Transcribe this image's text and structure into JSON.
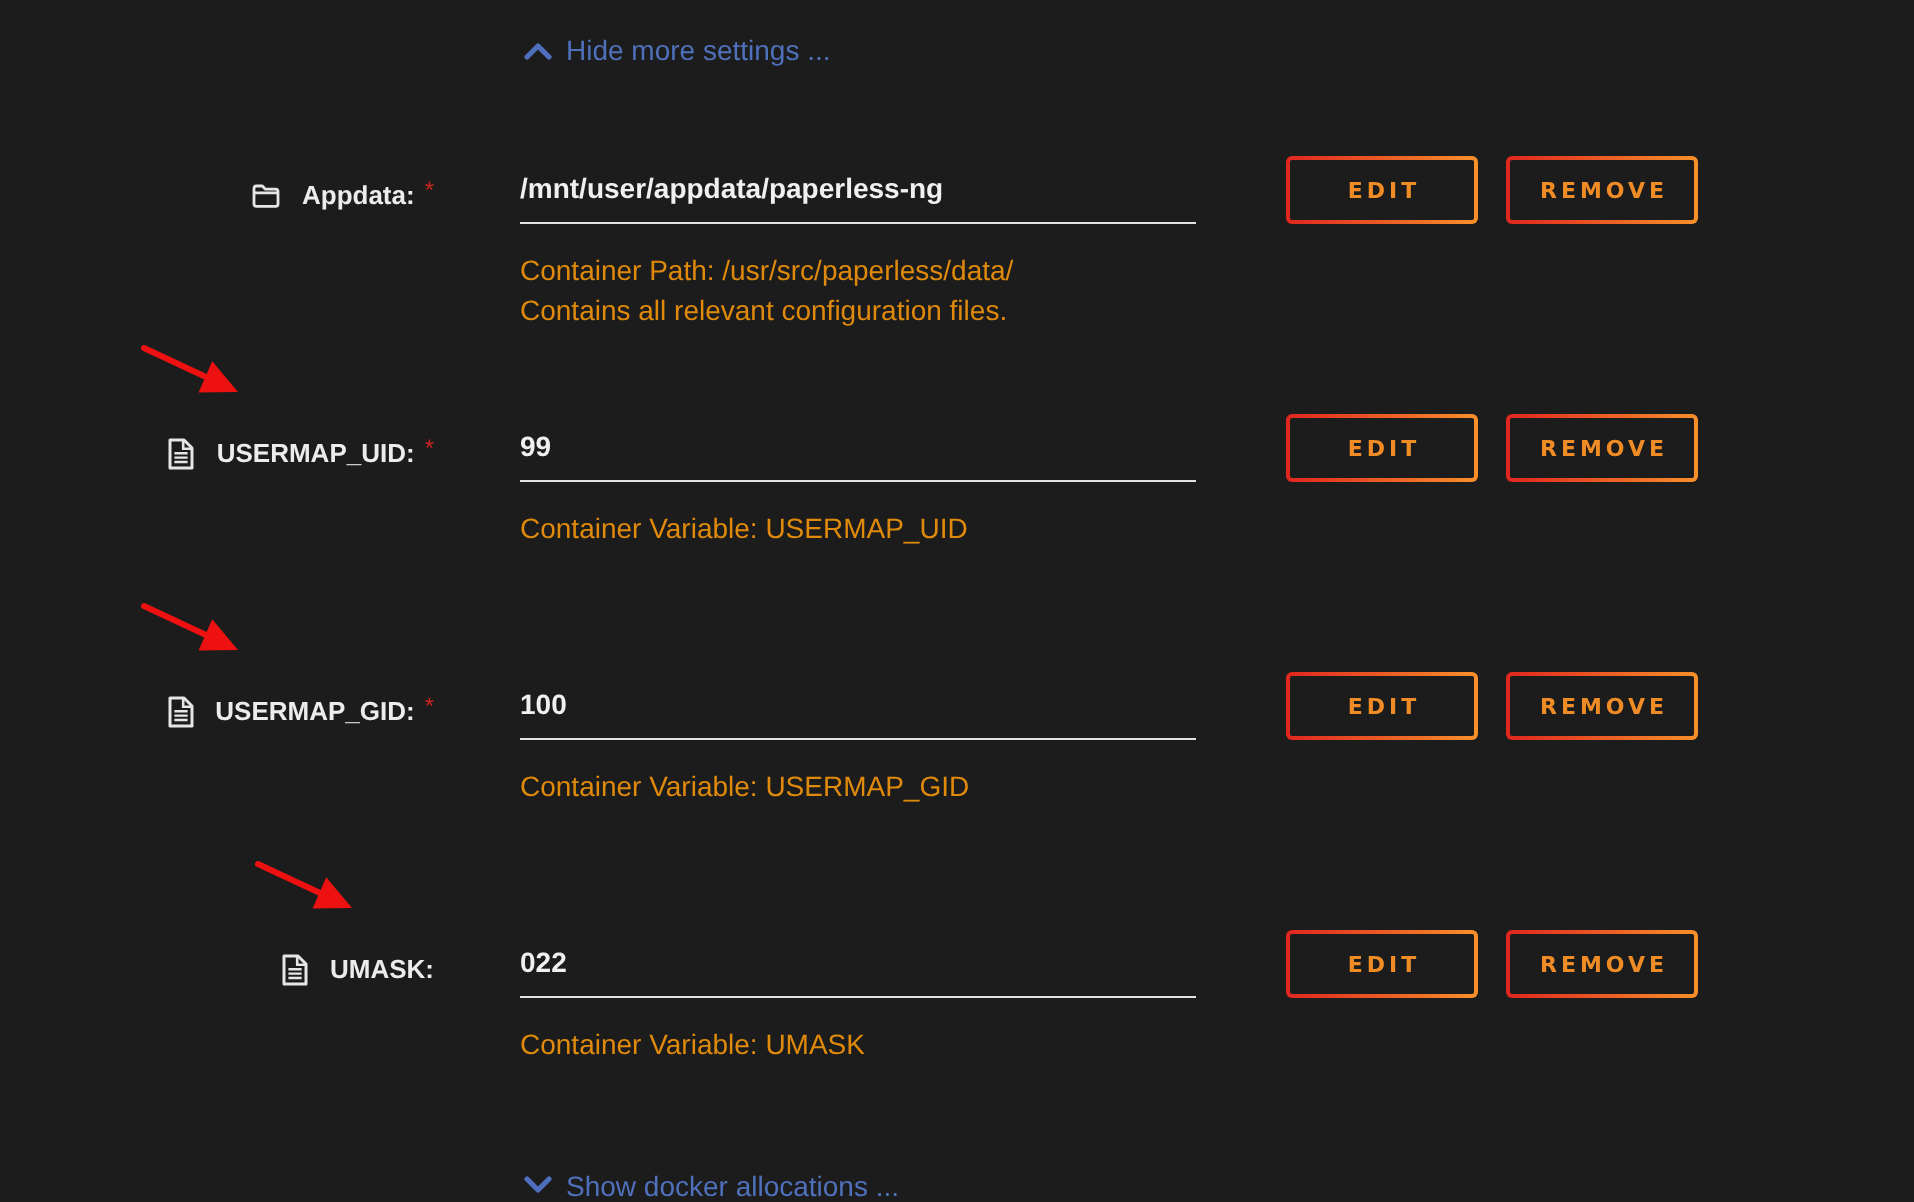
{
  "toggle_link": {
    "label": "Hide more settings ...",
    "expanded": true
  },
  "settings": [
    {
      "kind": "path",
      "label": "Appdata:",
      "required_mark": "*",
      "value": "/mnt/user/appdata/paperless-ng",
      "description": [
        "Container Path: /usr/src/paperless/data/",
        "Contains all relevant configuration files."
      ],
      "buttons": [
        "EDIT",
        "REMOVE"
      ],
      "annotated": false
    },
    {
      "kind": "variable",
      "label": "USERMAP_UID:",
      "required_mark": "*",
      "value": "99",
      "description": [
        "Container Variable: USERMAP_UID"
      ],
      "buttons": [
        "EDIT",
        "REMOVE"
      ],
      "annotated": true
    },
    {
      "kind": "variable",
      "label": "USERMAP_GID:",
      "required_mark": "*",
      "value": "100",
      "description": [
        "Container Variable: USERMAP_GID"
      ],
      "buttons": [
        "EDIT",
        "REMOVE"
      ],
      "annotated": true
    },
    {
      "kind": "variable",
      "label": "UMASK:",
      "value": "022",
      "description": [
        "Container Variable: UMASK"
      ],
      "buttons": [
        "EDIT",
        "REMOVE"
      ],
      "annotated": true
    }
  ],
  "footer_link": {
    "label": "Show docker allocations ...",
    "expanded": false
  }
}
